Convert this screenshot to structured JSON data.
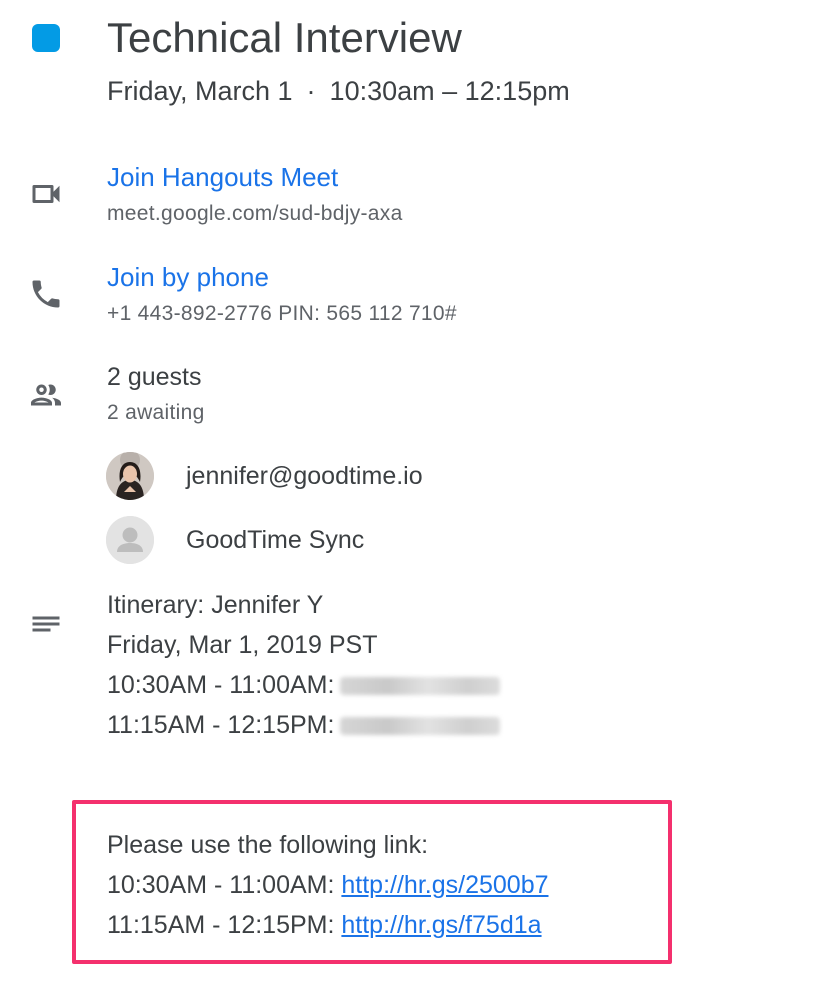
{
  "event": {
    "color": "#039be5",
    "title": "Technical Interview",
    "date": "Friday, March 1",
    "separator": "·",
    "time": "10:30am – 12:15pm"
  },
  "video": {
    "icon": "videocam-icon",
    "label": "Join Hangouts Meet",
    "url": "meet.google.com/sud-bdjy-axa"
  },
  "phone": {
    "icon": "phone-icon",
    "label": "Join by phone",
    "details": "+1 443-892-2776 PIN: 565 112 710#"
  },
  "guests": {
    "icon": "people-icon",
    "count": "2 guests",
    "status": "2 awaiting",
    "list": [
      {
        "name": "jennifer@goodtime.io",
        "avatar": "photo-avatar"
      },
      {
        "name": "GoodTime Sync",
        "avatar": "default-avatar"
      }
    ]
  },
  "description": {
    "icon": "notes-icon",
    "lines": [
      "Itinerary: Jennifer Y",
      "Friday, Mar 1, 2019 PST",
      "10:30AM - 11:00AM:",
      "11:15AM - 12:15PM:"
    ]
  },
  "links_box": {
    "border_color": "#f4306d",
    "intro": "Please use the following link:",
    "rows": [
      {
        "time": "10:30AM - 11:00AM:",
        "url": "http://hr.gs/2500b7"
      },
      {
        "time": "11:15AM - 12:15PM:",
        "url": "http://hr.gs/f75d1a"
      }
    ]
  }
}
